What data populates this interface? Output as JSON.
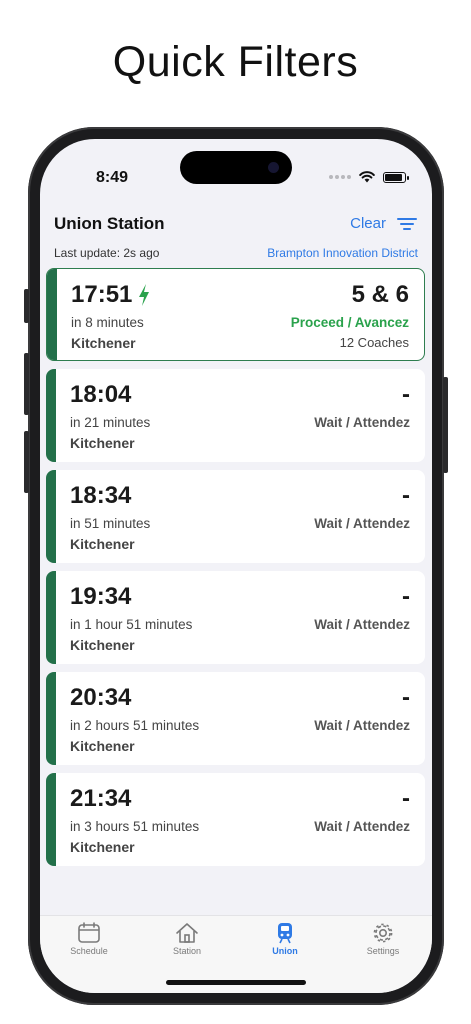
{
  "headline": "Quick Filters",
  "status_bar": {
    "time": "8:49",
    "battery_level": 0.9
  },
  "header": {
    "title": "Union Station",
    "clear_label": "Clear",
    "filter_icon": "filter-icon"
  },
  "subheader": {
    "last_update": "Last update: 2s ago",
    "district": "Brampton Innovation District"
  },
  "colors": {
    "accent": "#2f7ae5",
    "line": "#23704a",
    "proceed": "#2aa24c"
  },
  "departures": [
    {
      "time": "17:51",
      "relative": "in 8 minutes",
      "destination": "Kitchener",
      "platform": "5 & 6",
      "status": "Proceed / Avancez",
      "coaches": "12 Coaches",
      "active": true,
      "icon": "bolt-icon"
    },
    {
      "time": "18:04",
      "relative": "in 21 minutes",
      "destination": "Kitchener",
      "platform": "-",
      "status": "Wait / Attendez",
      "coaches": "",
      "active": false
    },
    {
      "time": "18:34",
      "relative": "in 51 minutes",
      "destination": "Kitchener",
      "platform": "-",
      "status": "Wait / Attendez",
      "coaches": "",
      "active": false
    },
    {
      "time": "19:34",
      "relative": "in 1 hour 51 minutes",
      "destination": "Kitchener",
      "platform": "-",
      "status": "Wait / Attendez",
      "coaches": "",
      "active": false
    },
    {
      "time": "20:34",
      "relative": "in 2 hours 51 minutes",
      "destination": "Kitchener",
      "platform": "-",
      "status": "Wait / Attendez",
      "coaches": "",
      "active": false
    },
    {
      "time": "21:34",
      "relative": "in 3 hours 51 minutes",
      "destination": "Kitchener",
      "platform": "-",
      "status": "Wait / Attendez",
      "coaches": "",
      "active": false
    }
  ],
  "tabs": [
    {
      "label": "Schedule",
      "icon": "calendar-icon",
      "active": false
    },
    {
      "label": "Station",
      "icon": "house-icon",
      "active": false
    },
    {
      "label": "Union",
      "icon": "train-icon",
      "active": true
    },
    {
      "label": "Settings",
      "icon": "gear-icon",
      "active": false
    }
  ]
}
